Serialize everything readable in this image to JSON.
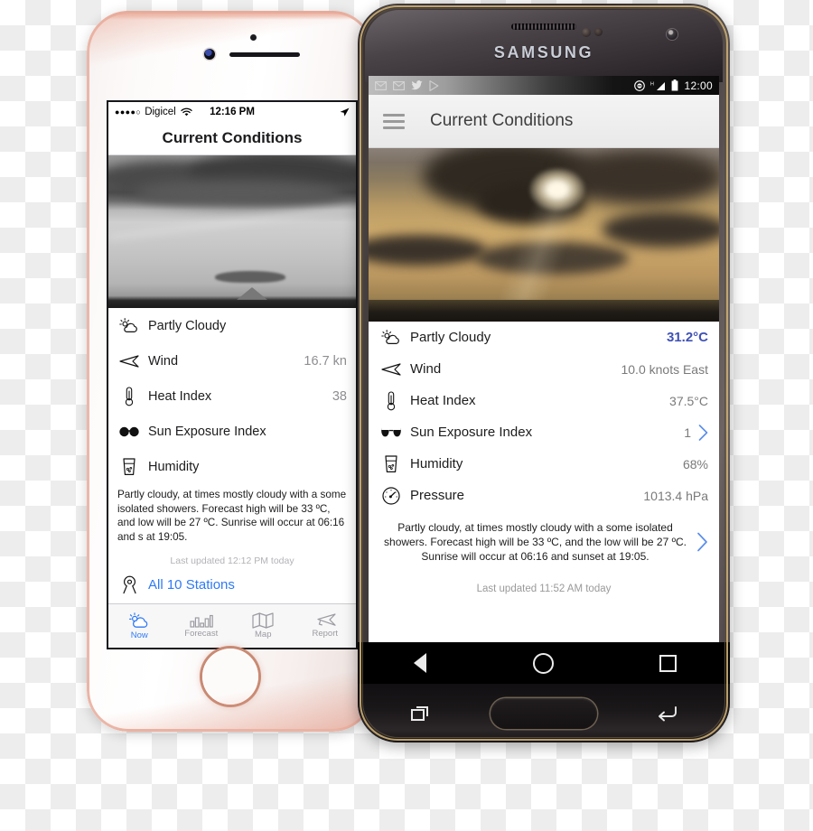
{
  "iphone": {
    "device_name": "iPhone rose gold",
    "status": {
      "signal_dots": "●●●●○",
      "carrier": "Digicel",
      "wifi_icon": "wifi-icon",
      "time": "12:16 PM",
      "location_icon": "location-arrow-icon"
    },
    "navbar_title": "Current Conditions",
    "photo_alt": "grayscale sky over ocean with island",
    "rows": [
      {
        "icon": "partly-cloudy-icon",
        "label": "Partly Cloudy",
        "value": ""
      },
      {
        "icon": "wind-icon",
        "label": "Wind",
        "value": "16.7 kn"
      },
      {
        "icon": "thermometer-icon",
        "label": "Heat Index",
        "value": "38"
      },
      {
        "icon": "sunglasses-icon",
        "label": "Sun Exposure Index",
        "value": ""
      },
      {
        "icon": "humidity-glass-icon",
        "label": "Humidity",
        "value": ""
      }
    ],
    "description": "Partly cloudy, at times mostly cloudy with a some isolated showers. Forecast high will be 33 ºC, and low will be 27 ºC. Sunrise will occur at 06:16 and s at 19:05.",
    "last_updated": "Last updated 12:12 PM today",
    "stations_link": "All 10 Stations",
    "stations_icon": "map-pin-icon",
    "tabs": [
      {
        "icon": "sun-cloud-icon",
        "label": "Now",
        "active": true
      },
      {
        "icon": "bar-chart-icon",
        "label": "Forecast",
        "active": false
      },
      {
        "icon": "map-icon",
        "label": "Map",
        "active": false
      },
      {
        "icon": "megaphone-icon",
        "label": "Report",
        "active": false
      }
    ]
  },
  "samsung": {
    "brand": "SAMSUNG",
    "status": {
      "left_icons": [
        "gmail-icon",
        "gmail-icon",
        "twitter-icon",
        "play-store-icon"
      ],
      "right_icons": [
        "do-not-disturb-icon",
        "signal-h-icon",
        "battery-icon"
      ],
      "clock": "12:00"
    },
    "appbar": {
      "menu_icon": "hamburger-menu-icon",
      "title": "Current Conditions"
    },
    "photo_alt": "golden sunset sky with clouds over ocean",
    "rows": [
      {
        "icon": "partly-cloudy-icon",
        "label": "Partly Cloudy",
        "value": "31.2°C",
        "accent": true,
        "chevron": false
      },
      {
        "icon": "wind-icon",
        "label": "Wind",
        "value": "10.0 knots East",
        "accent": false,
        "chevron": false
      },
      {
        "icon": "thermometer-icon",
        "label": "Heat Index",
        "value": "37.5°C",
        "accent": false,
        "chevron": false
      },
      {
        "icon": "sunglasses-icon",
        "label": "Sun Exposure Index",
        "value": "1",
        "accent": false,
        "chevron": true
      },
      {
        "icon": "humidity-glass-icon",
        "label": "Humidity",
        "value": "68%",
        "accent": false,
        "chevron": false
      },
      {
        "icon": "pressure-gauge-icon",
        "label": "Pressure",
        "value": "1013.4 hPa",
        "accent": false,
        "chevron": false
      }
    ],
    "description": "Partly cloudy, at times mostly cloudy with a some isolated showers. Forecast high will be 33 ºC, and the low will be 27 ºC. Sunrise will occur at 06:16 and sunset at 19:05.",
    "last_updated": "Last updated 11:52 AM today",
    "navbar": [
      {
        "icon": "back-triangle-icon",
        "label": "Back"
      },
      {
        "icon": "home-circle-icon",
        "label": "Home"
      },
      {
        "icon": "recents-square-icon",
        "label": "Recents"
      }
    ],
    "hardware": [
      {
        "icon": "recent-apps-icon",
        "label": "Recent apps"
      },
      {
        "icon": "physical-home-button",
        "label": "Home"
      },
      {
        "icon": "back-arrow-icon",
        "label": "Back"
      }
    ]
  },
  "colors": {
    "ios_accent": "#2f7af5",
    "android_accent": "#3f51b5",
    "android_chevron": "#5b8dea",
    "muted_text": "#8e8e93",
    "rose_gold": "#e8a895",
    "samsung_gold": "#c9ab72"
  }
}
